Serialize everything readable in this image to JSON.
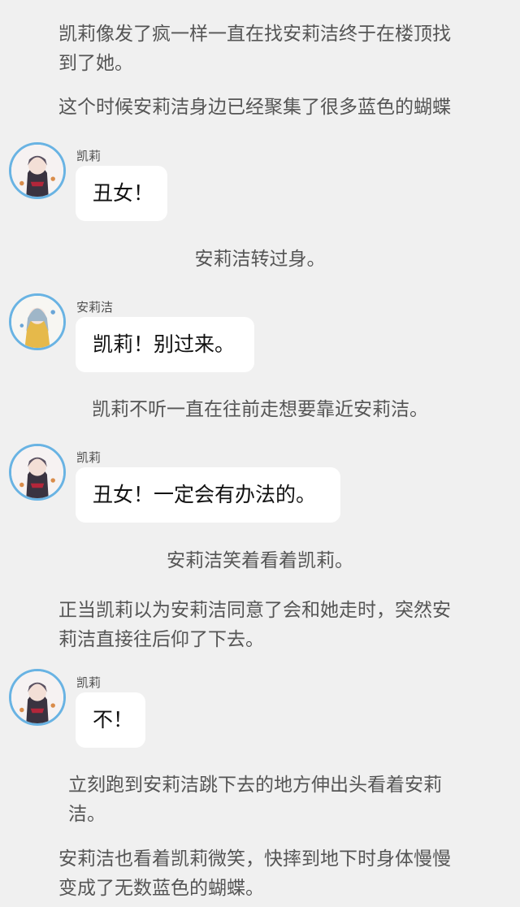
{
  "narrations": {
    "n1": "凯莉像发了疯一样一直在找安莉洁终于在楼顶找到了她。",
    "n2": "这个时候安莉洁身边已经聚集了很多蓝色的蝴蝶",
    "n3": "安莉洁转过身。",
    "n4": "凯莉不听一直在往前走想要靠近安莉洁。",
    "n5": "安莉洁笑着看着凯莉。",
    "n6": "正当凯莉以为安莉洁同意了会和她走时，突然安莉洁直接往后仰了下去。",
    "n7": "立刻跑到安莉洁跳下去的地方伸出头看着安莉洁。",
    "n8": "安莉洁也看着凯莉微笑，快摔到地下时身体慢慢变成了无数蓝色的蝴蝶。"
  },
  "messages": [
    {
      "speaker": "凯莉",
      "text": "丑女！",
      "avatar": "kaili-avatar"
    },
    {
      "speaker": "安莉洁",
      "text": "凯莉！别过来。",
      "avatar": "anlijie-avatar"
    },
    {
      "speaker": "凯莉",
      "text": "丑女！一定会有办法的。",
      "avatar": "kaili-avatar"
    },
    {
      "speaker": "凯莉",
      "text": "不！",
      "avatar": "kaili-avatar"
    }
  ],
  "colors": {
    "background": "#f0f0f0",
    "bubble": "#ffffff",
    "avatar_ring": "#69b3e3"
  }
}
